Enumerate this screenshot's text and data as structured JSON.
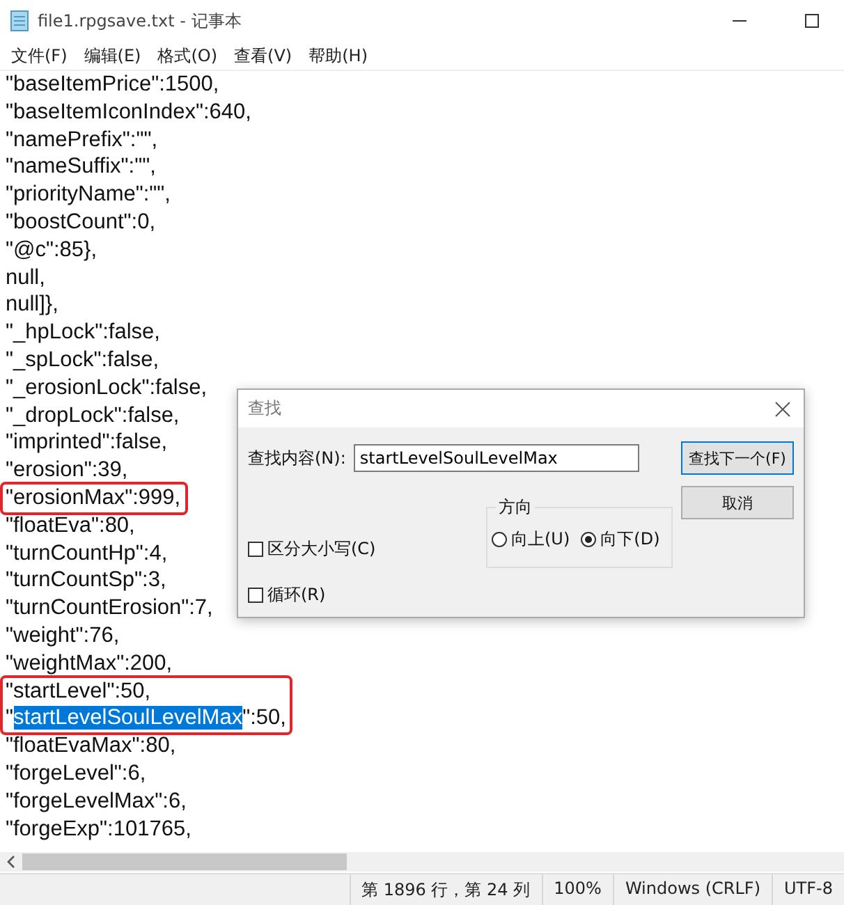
{
  "window": {
    "title": "file1.rpgsave.txt - 记事本"
  },
  "menu": [
    {
      "label": "文件(F)"
    },
    {
      "label": "编辑(E)"
    },
    {
      "label": "格式(O)"
    },
    {
      "label": "查看(V)"
    },
    {
      "label": "帮助(H)"
    }
  ],
  "editor": {
    "blocks": [
      {
        "kind": "plain",
        "lines": [
          {
            "text": "\"baseItemPrice\":1500,"
          },
          {
            "text": "\"baseItemIconIndex\":640,"
          },
          {
            "text": "\"namePrefix\":\"\","
          },
          {
            "text": "\"nameSuffix\":\"\","
          },
          {
            "text": "\"priorityName\":\"\","
          },
          {
            "text": "\"boostCount\":0,"
          },
          {
            "text": "\"@c\":85},"
          },
          {
            "text": "null,"
          },
          {
            "text": "null]},"
          },
          {
            "text": "\"_hpLock\":false,"
          },
          {
            "text": "\"_spLock\":false,"
          },
          {
            "text": "\"_erosionLock\":false,"
          },
          {
            "text": "\"_dropLock\":false,"
          },
          {
            "text": "\"imprinted\":false,"
          },
          {
            "text": "\"erosion\":39,"
          }
        ]
      },
      {
        "kind": "boxed",
        "lines": [
          {
            "text": "\"erosionMax\":999,"
          }
        ]
      },
      {
        "kind": "plain",
        "lines": [
          {
            "text": "\"floatEva\":80,"
          },
          {
            "text": "\"turnCountHp\":4,"
          },
          {
            "text": "\"turnCountSp\":3,"
          },
          {
            "text": "\"turnCountErosion\":7,"
          },
          {
            "text": "\"weight\":76,"
          },
          {
            "text": "\"weightMax\":200,"
          }
        ]
      },
      {
        "kind": "boxed",
        "lines": [
          {
            "text": "\"startLevel\":50,"
          },
          {
            "before": "\"",
            "selected": "startLevelSoulLevelMax",
            "after": "\":50,"
          }
        ]
      },
      {
        "kind": "plain",
        "lines": [
          {
            "text": "\"floatEvaMax\":80,"
          },
          {
            "text": "\"forgeLevel\":6,"
          },
          {
            "text": "\"forgeLevelMax\":6,"
          },
          {
            "text": "\"forgeExp\":101765,"
          }
        ]
      }
    ]
  },
  "find_dialog": {
    "title": "查找",
    "find_label": "查找内容(N):",
    "find_value": "startLevelSoulLevelMax",
    "buttons": [
      {
        "label": "查找下一个(F)",
        "focused": true
      },
      {
        "label": "取消",
        "focused": false
      }
    ],
    "direction": {
      "label": "方向",
      "options": [
        {
          "label": "向上(U)",
          "selected": false
        },
        {
          "label": "向下(D)",
          "selected": true
        }
      ]
    },
    "options": [
      {
        "label": "区分大小写(C)",
        "checked": false
      },
      {
        "label": "循环(R)",
        "checked": false
      }
    ]
  },
  "status_bar": [
    {
      "text": "第 1896 行，第 24 列"
    },
    {
      "text": "100%"
    },
    {
      "text": "Windows (CRLF)"
    },
    {
      "text": "UTF-8"
    }
  ]
}
